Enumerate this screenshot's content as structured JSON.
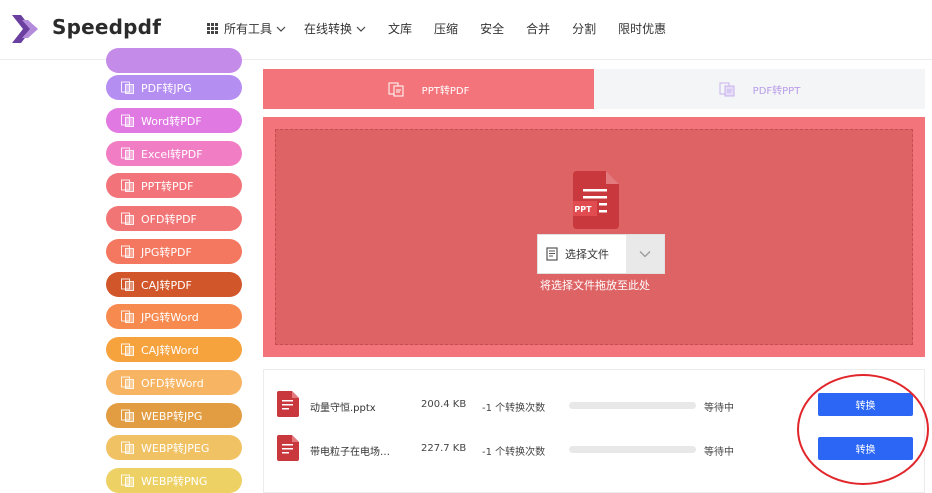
{
  "brand": {
    "name": "Speedpdf",
    "logo_icon": "speedpdf-logo-icon"
  },
  "nav": {
    "items": [
      {
        "label": "所有工具",
        "icon": "grid-icon",
        "has_dropdown": true
      },
      {
        "label": "在线转换",
        "has_dropdown": true
      },
      {
        "label": "文库"
      },
      {
        "label": "压缩"
      },
      {
        "label": "安全"
      },
      {
        "label": "合并"
      },
      {
        "label": "分割"
      },
      {
        "label": "限时优惠"
      }
    ]
  },
  "sidebar": {
    "items": [
      {
        "label": "",
        "color": "#c58be9"
      },
      {
        "label": "PDF转JPG",
        "color": "#b58ef2"
      },
      {
        "label": "Word转PDF",
        "color": "#e079e2"
      },
      {
        "label": "Excel转PDF",
        "color": "#f17ec4"
      },
      {
        "label": "PPT转PDF",
        "color": "#f2747a"
      },
      {
        "label": "OFD转PDF",
        "color": "#f27576"
      },
      {
        "label": "JPG转PDF",
        "color": "#f47860"
      },
      {
        "label": "CAJ转PDF",
        "color": "#d1572a"
      },
      {
        "label": "JPG转Word",
        "color": "#f78a4f"
      },
      {
        "label": "CAJ转Word",
        "color": "#f6a23d"
      },
      {
        "label": "OFD转Word",
        "color": "#f7b462"
      },
      {
        "label": "WEBP转JPG",
        "color": "#e29d42"
      },
      {
        "label": "WEBP转JPEG",
        "color": "#f0c264"
      },
      {
        "label": "WEBP转PNG",
        "color": "#eed164"
      }
    ]
  },
  "tabs": [
    {
      "label": "PPT转PDF",
      "active": true
    },
    {
      "label": "PDF转PPT",
      "active": false
    }
  ],
  "dropzone": {
    "file_type_badge": "PPT",
    "select_label": "选择文件",
    "hint": "将选择文件拖放至此处"
  },
  "files": [
    {
      "name": "动量守恒.pptx",
      "size": "200.4 KB",
      "count": "-1 个转换次数",
      "progress": 0,
      "status": "等待中",
      "button": "转换"
    },
    {
      "name": "带电粒子在电场…",
      "size": "227.7 KB",
      "count": "-1 个转换次数",
      "progress": 0,
      "status": "等待中",
      "button": "转换"
    }
  ],
  "colors": {
    "accent_red": "#f3747a",
    "drop_inner": "#de6365",
    "convert_blue": "#2b66f5",
    "annotation_red": "#e1262b"
  }
}
